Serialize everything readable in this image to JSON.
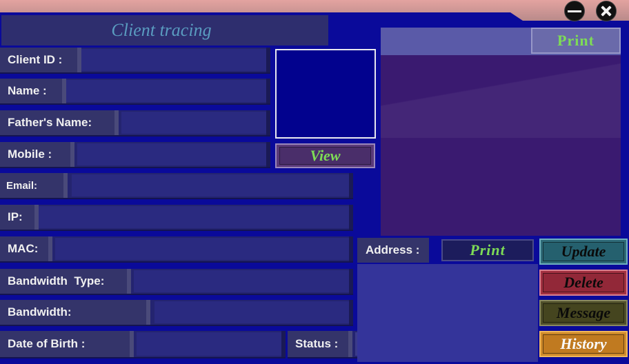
{
  "window": {
    "minimize_icon": "minimize-icon",
    "close_icon": "close-icon"
  },
  "header": {
    "title": "Client tracing"
  },
  "form": {
    "client_id": {
      "label": "Client ID :",
      "value": ""
    },
    "name": {
      "label": "Name :",
      "value": ""
    },
    "fathers_name": {
      "label": "Father's Name:",
      "value": ""
    },
    "mobile": {
      "label": "Mobile :",
      "value": ""
    },
    "email": {
      "label": "Email:",
      "value": ""
    },
    "ip": {
      "label": "IP:",
      "value": ""
    },
    "mac": {
      "label": "MAC:",
      "value": ""
    },
    "bandwidth_type": {
      "label": "Bandwidth  Type:",
      "value": ""
    },
    "bandwidth": {
      "label": "Bandwidth:",
      "value": ""
    },
    "date_of_birth": {
      "label": "Date of Birth :",
      "value": ""
    },
    "status": {
      "label": "Status :",
      "value": ""
    }
  },
  "photo": {
    "view_label": "View"
  },
  "preview": {
    "print_label": "Print"
  },
  "address": {
    "label": "Address :",
    "print_label": "Print",
    "value": ""
  },
  "actions": {
    "update_label": "Update",
    "delete_label": "Delete",
    "message_label": "Message",
    "history_label": "History"
  },
  "colors": {
    "background": "#0a0a9a",
    "title_bar": "#d49a98",
    "accent_text": "#7edc56",
    "header_text": "#5a9cc0"
  }
}
